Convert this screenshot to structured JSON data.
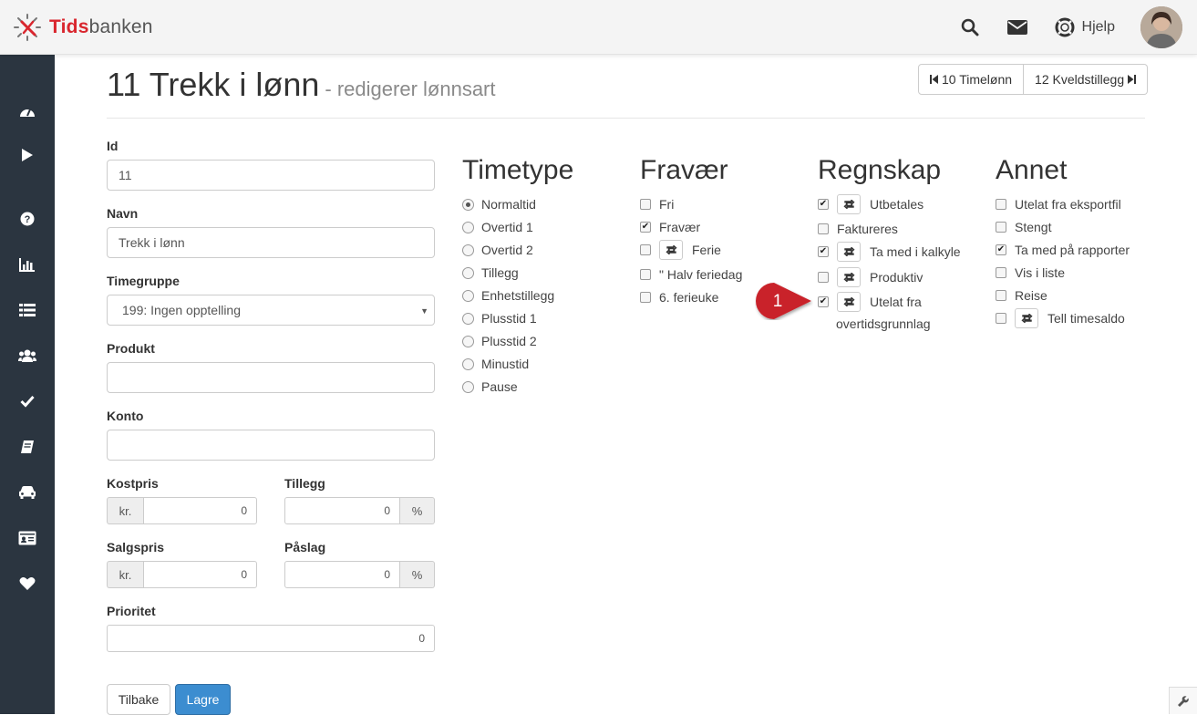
{
  "brand": {
    "part1": "Tids",
    "part2": "banken"
  },
  "nav": {
    "help_label": "Hjelp"
  },
  "sidebar": [
    "dashboard-icon",
    "play-icon",
    "help-icon",
    "chart-icon",
    "list-icon",
    "users-icon",
    "check-icon",
    "book-icon",
    "car-icon",
    "id-card-icon",
    "heart-icon"
  ],
  "page": {
    "title": "11 Trekk i lønn",
    "subtitle": "- redigerer lønnsart"
  },
  "pager": {
    "prev_label": "10 Timelønn",
    "next_label": "12 Kveldstillegg"
  },
  "form": {
    "id_label": "Id",
    "id_value": "11",
    "name_label": "Navn",
    "name_value": "Trekk i lønn",
    "group_label": "Timegruppe",
    "group_value": "199: Ingen opptelling",
    "product_label": "Produkt",
    "product_value": "",
    "account_label": "Konto",
    "account_value": "",
    "cost_label": "Kostpris",
    "cost_prefix": "kr.",
    "cost_value": "0",
    "addition_label": "Tillegg",
    "addition_value": "0",
    "addition_suffix": "%",
    "sale_label": "Salgspris",
    "sale_prefix": "kr.",
    "sale_value": "0",
    "markup_label": "Påslag",
    "markup_value": "0",
    "markup_suffix": "%",
    "priority_label": "Prioritet",
    "priority_value": "0",
    "back_label": "Tilbake",
    "save_label": "Lagre"
  },
  "timetype": {
    "heading": "Timetype",
    "options": [
      "Normaltid",
      "Overtid 1",
      "Overtid 2",
      "Tillegg",
      "Enhetstillegg",
      "Plusstid 1",
      "Plusstid 2",
      "Minustid",
      "Pause"
    ],
    "selected": "Normaltid"
  },
  "absence": {
    "heading": "Fravær",
    "items": [
      {
        "label": "Fri",
        "checked": false
      },
      {
        "label": "Fravær",
        "checked": true
      },
      {
        "label": "Ferie",
        "checked": false,
        "toggle": true
      },
      {
        "label": "\" Halv feriedag",
        "checked": false
      },
      {
        "label": "6. ferieuke",
        "checked": false
      }
    ]
  },
  "accounting": {
    "heading": "Regnskap",
    "items": [
      {
        "label": "Utbetales",
        "checked": true,
        "toggle": true
      },
      {
        "label": "Faktureres",
        "checked": false
      },
      {
        "label": "Ta med i kalkyle",
        "checked": true,
        "toggle": true
      },
      {
        "label": "Produktiv",
        "checked": false,
        "toggle": true
      },
      {
        "label": "Utelat fra",
        "label2": "overtidsgrunnlag",
        "checked": true,
        "toggle": true
      }
    ]
  },
  "other": {
    "heading": "Annet",
    "items": [
      {
        "label": "Utelat fra eksportfil",
        "checked": false
      },
      {
        "label": "Stengt",
        "checked": false
      },
      {
        "label": "Ta med på rapporter",
        "checked": true
      },
      {
        "label": "Vis i liste",
        "checked": false
      },
      {
        "label": "Reise",
        "checked": false
      },
      {
        "label": "Tell timesaldo",
        "checked": false,
        "toggle": true
      }
    ]
  },
  "marker": {
    "label": "1",
    "color": "#c9242b"
  },
  "colors": {
    "sidebar": "#2b3540",
    "primary": "#3c8dd0",
    "brand_red": "#d9262e"
  }
}
